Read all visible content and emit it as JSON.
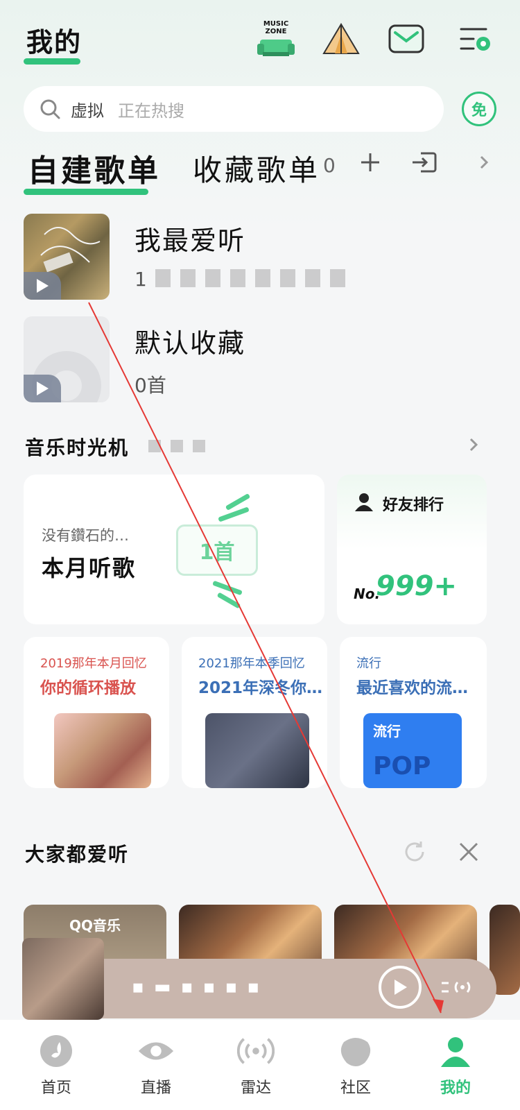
{
  "header": {
    "title": "我的",
    "music_zone_label": "MUSIC ZONE"
  },
  "search": {
    "placeholder_left": "虚拟",
    "placeholder_right": "正在热搜",
    "free_badge": "免"
  },
  "playlist_tabs": {
    "self_built": "自建歌单",
    "collected": "收藏歌单",
    "collected_count": "0"
  },
  "playlists": [
    {
      "name": "我最爱听",
      "sub": "1"
    },
    {
      "name": "默认收藏",
      "sub": "0首"
    }
  ],
  "time_machine": {
    "title": "音乐时光机",
    "month_card": {
      "subtitle": "没有鑽石的…",
      "title": "本月听歌",
      "song_count": "1首"
    },
    "friends_card": {
      "label": "好友排行",
      "rank_prefix": "No.",
      "rank_value": "999+"
    },
    "mini_cards": [
      {
        "tag": "2019那年本月回忆",
        "title": "你的循环播放",
        "tag_color": "#d9534f"
      },
      {
        "tag": "2021那年本季回忆",
        "title": "2021年深冬你…",
        "tag_color": "#3b6fb6"
      },
      {
        "tag": "流行",
        "title": "最近喜欢的流…",
        "tag_color": "#3b6fb6",
        "art_label_top": "流行",
        "art_label_bottom": "POP"
      }
    ]
  },
  "everyone_loves": {
    "title": "大家都爱听",
    "card_brand": "QQ音乐"
  },
  "now_playing": {
    "title": "▪ ▬ ▪ ▪ ▪ ▪"
  },
  "bottom_nav": [
    {
      "label": "首页",
      "icon": "home-icon"
    },
    {
      "label": "直播",
      "icon": "eye-icon"
    },
    {
      "label": "雷达",
      "icon": "radar-icon"
    },
    {
      "label": "社区",
      "icon": "community-icon"
    },
    {
      "label": "我的",
      "icon": "profile-icon",
      "active": true
    }
  ],
  "colors": {
    "accent": "#31c27c",
    "now_playing_bg": "#c9b6ad"
  }
}
